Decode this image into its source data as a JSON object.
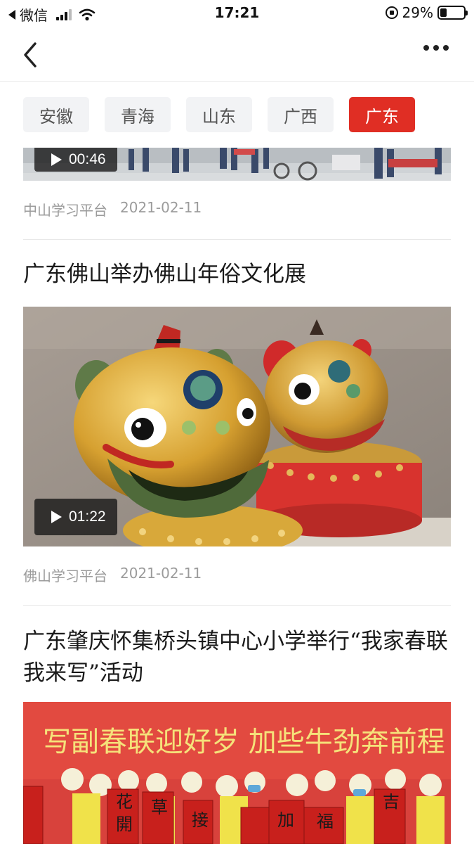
{
  "status_bar": {
    "carrier": "微信",
    "time": "17:21",
    "battery": "29%",
    "battery_level": 0.29
  },
  "nav": {
    "back_icon": "chevron-left-icon",
    "more_icon": "more-horizontal-icon"
  },
  "tabs": [
    {
      "label": "安徽",
      "active": false
    },
    {
      "label": "青海",
      "active": false
    },
    {
      "label": "山东",
      "active": false
    },
    {
      "label": "广西",
      "active": false
    },
    {
      "label": "广东",
      "active": true
    }
  ],
  "articles": [
    {
      "title": "",
      "video_duration": "00:46",
      "source": "中山学习平台",
      "date": "2021-02-11"
    },
    {
      "title": "广东佛山举办佛山年俗文化展",
      "video_duration": "01:22",
      "source": "佛山学习平台",
      "date": "2021-02-11"
    },
    {
      "title": "广东肇庆怀集桥头镇中心小学举行“我家春联我来写”活动",
      "banner_text": "写副春联迎好岁 加些牛劲奔前程",
      "paper_chars": [
        "花",
        "開",
        "草",
        "接",
        "加",
        "福",
        "吉"
      ]
    }
  ],
  "colors": {
    "accent": "#e02e24",
    "tab_bg": "#f2f3f5",
    "meta_text": "#9b9b9b"
  }
}
